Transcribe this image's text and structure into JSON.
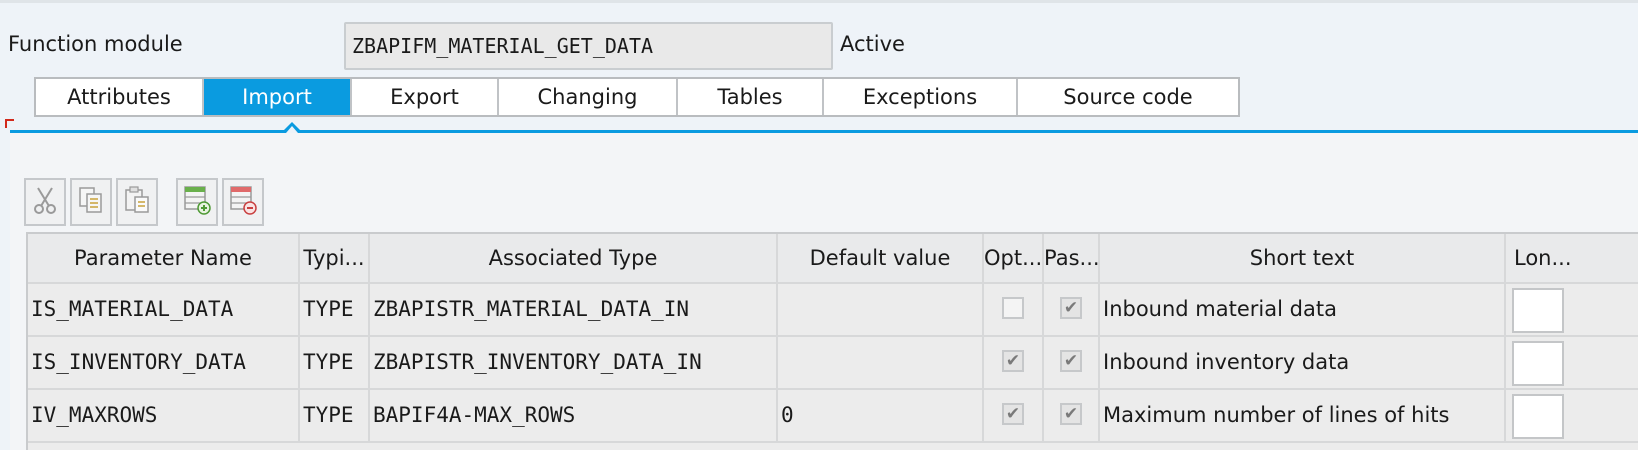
{
  "header": {
    "label": "Function module",
    "name": "ZBAPIFM_MATERIAL_GET_DATA",
    "status": "Active"
  },
  "tabs": [
    {
      "label": "Attributes"
    },
    {
      "label": "Import"
    },
    {
      "label": "Export"
    },
    {
      "label": "Changing"
    },
    {
      "label": "Tables"
    },
    {
      "label": "Exceptions"
    },
    {
      "label": "Source code"
    }
  ],
  "toolbar": {
    "icons": [
      "cut-icon",
      "copy-icon",
      "paste-icon",
      "insert-row-icon",
      "delete-row-icon"
    ]
  },
  "table": {
    "columns": [
      "Parameter Name",
      "Typi...",
      "Associated Type",
      "Default value",
      "Opt...",
      "Pas...",
      "Short text",
      "Lon..."
    ],
    "rows": [
      {
        "name": "IS_MATERIAL_DATA",
        "typing": "TYPE",
        "assoc": "ZBAPISTR_MATERIAL_DATA_IN",
        "default": "",
        "optional": false,
        "pass_value": true,
        "short_text": "Inbound material data"
      },
      {
        "name": "IS_INVENTORY_DATA",
        "typing": "TYPE",
        "assoc": "ZBAPISTR_INVENTORY_DATA_IN",
        "default": "",
        "optional": true,
        "pass_value": true,
        "short_text": "Inbound inventory data"
      },
      {
        "name": "IV_MAXROWS",
        "typing": "TYPE",
        "assoc": "BAPIF4A-MAX_ROWS",
        "default": "0",
        "optional": true,
        "pass_value": true,
        "short_text": "Maximum number of lines of hits"
      }
    ]
  },
  "colors": {
    "accent": "#0a9be0"
  }
}
